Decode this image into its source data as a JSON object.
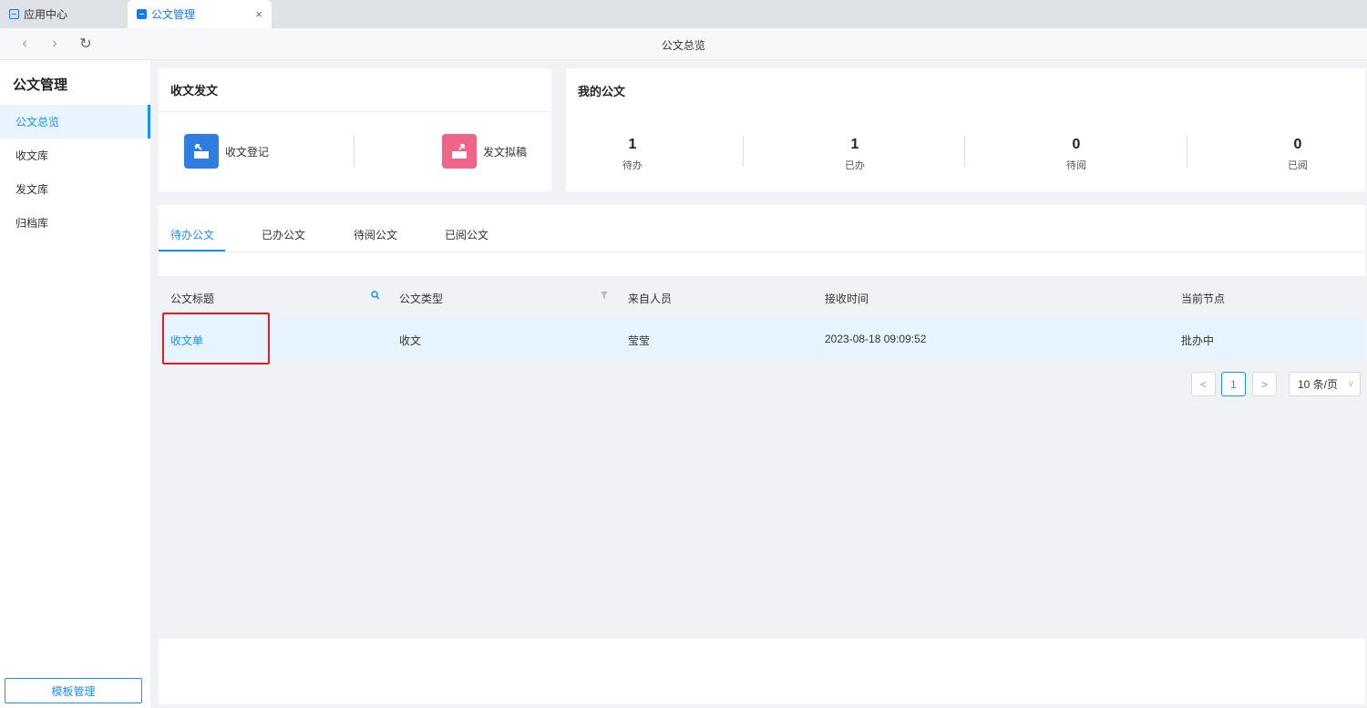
{
  "tabs": [
    {
      "label": "应用中心",
      "active": false
    },
    {
      "label": "公文管理",
      "active": true
    }
  ],
  "tab_close": "×",
  "nav": {
    "back": "‹",
    "forward": "›",
    "refresh": "↻",
    "title": "公文总览"
  },
  "sidebar": {
    "title": "公文管理",
    "items": [
      {
        "label": "公文总览",
        "active": true
      },
      {
        "label": "收文库",
        "active": false
      },
      {
        "label": "发文库",
        "active": false
      },
      {
        "label": "归档库",
        "active": false
      }
    ],
    "template_button": "模板管理"
  },
  "send_receive": {
    "title": "收文发文",
    "actions": [
      {
        "label": "收文登记",
        "icon": "inbox-tray-icon",
        "color": "#2f7de1"
      },
      {
        "label": "发文拟稿",
        "icon": "outbox-tray-icon",
        "color": "#f0648a"
      }
    ]
  },
  "my_docs": {
    "title": "我的公文",
    "stats": [
      {
        "value": "1",
        "label": "待办"
      },
      {
        "value": "1",
        "label": "已办"
      },
      {
        "value": "0",
        "label": "待阅"
      },
      {
        "value": "0",
        "label": "已阅"
      }
    ]
  },
  "doc_tabs": [
    {
      "label": "待办公文",
      "active": true
    },
    {
      "label": "已办公文",
      "active": false
    },
    {
      "label": "待阅公文",
      "active": false
    },
    {
      "label": "已阅公文",
      "active": false
    }
  ],
  "table": {
    "columns": [
      "公文标题",
      "公文类型",
      "来自人员",
      "接收时间",
      "当前节点"
    ],
    "rows": [
      {
        "title": "收文单",
        "type": "收文",
        "from": "莹莹",
        "received": "2023-08-18 09:09:52",
        "node": "批办中"
      }
    ]
  },
  "pagination": {
    "prev": "<",
    "current_page": "1",
    "next": ">",
    "page_size": "10 条/页"
  },
  "colors": {
    "accent": "#1890ff",
    "highlight_border": "#e02020",
    "row_selected": "#e6f4ff"
  }
}
